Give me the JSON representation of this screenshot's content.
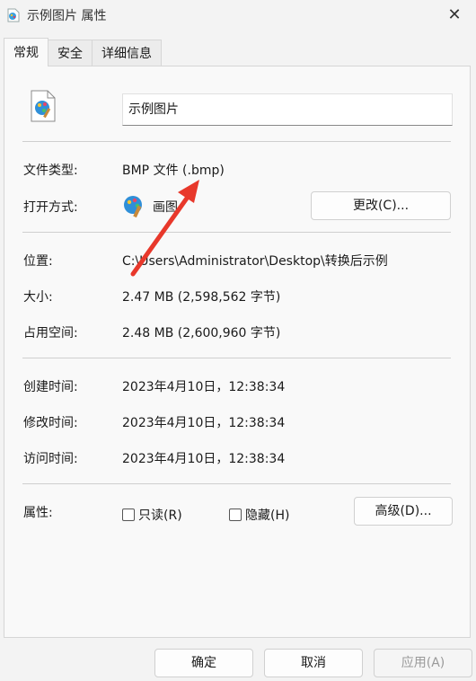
{
  "window": {
    "title": "示例图片 属性",
    "close_glyph": "✕"
  },
  "tabs": [
    {
      "label": "常规"
    },
    {
      "label": "安全"
    },
    {
      "label": "详细信息"
    }
  ],
  "general": {
    "filename": "示例图片",
    "file_type_label": "文件类型:",
    "file_type_value": "BMP 文件 (.bmp)",
    "open_with_label": "打开方式:",
    "open_with_value": "画图",
    "change_button": "更改(C)...",
    "location_label": "位置:",
    "location_value": "C:\\Users\\Administrator\\Desktop\\转换后示例",
    "size_label": "大小:",
    "size_value": "2.47 MB (2,598,562 字节)",
    "disk_size_label": "占用空间:",
    "disk_size_value": "2.48 MB (2,600,960 字节)",
    "created_label": "创建时间:",
    "created_value": "2023年4月10日，12:38:34",
    "modified_label": "修改时间:",
    "modified_value": "2023年4月10日，12:38:34",
    "accessed_label": "访问时间:",
    "accessed_value": "2023年4月10日，12:38:34",
    "attributes_label": "属性:",
    "readonly_label": "只读(R)",
    "hidden_label": "隐藏(H)",
    "advanced_button": "高级(D)..."
  },
  "footer": {
    "ok_button": "确定",
    "cancel_button": "取消",
    "apply_button": "应用(A)"
  },
  "colors": {
    "annotation_arrow": "#e8382b",
    "accent": "#0067c0"
  }
}
